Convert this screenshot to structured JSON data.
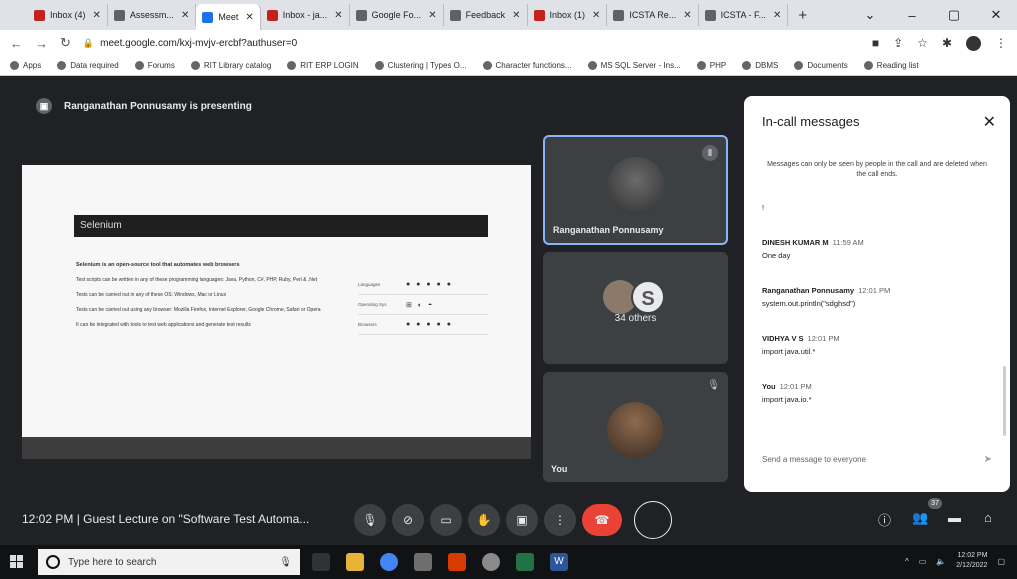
{
  "browser": {
    "tabs": [
      {
        "label": "Inbox (4)",
        "color": "#c5221f"
      },
      {
        "label": "Assessm...",
        "color": "#5f6368"
      },
      {
        "label": "Meet",
        "color": "#1a73e8"
      },
      {
        "label": "Inbox - ja...",
        "color": "#c5221f"
      },
      {
        "label": "Google Fo...",
        "color": "#5f6368"
      },
      {
        "label": "Feedback",
        "color": "#5f6368"
      },
      {
        "label": "Inbox (1)",
        "color": "#c5221f"
      },
      {
        "label": "ICSTA Re...",
        "color": "#5f6368"
      },
      {
        "label": "ICSTA - F...",
        "color": "#5f6368"
      }
    ],
    "url": "meet.google.com/kxj-mvjv-ercbf?authuser=0",
    "bookmarks": [
      "Apps",
      "Data required",
      "Forums",
      "RIT Library catalog",
      "RIT ERP LOGIN",
      "Clustering | Types O...",
      "Character functions...",
      "MS SQL Server - Ins...",
      "PHP",
      "DBMS",
      "Documents",
      "Reading list"
    ]
  },
  "meet": {
    "presenting_text": "Ranganathan Ponnusamy is presenting",
    "slide": {
      "title": "Selenium",
      "lines": [
        "Selenium is an open-source tool that automates web browsers",
        "Test scripts can be written in any of these programming languages: Java, Python, C#, PHP, Ruby, Perl & .Net",
        "Tests can be carried out in any of these OS: Windows, Mac or Linux",
        "Tests can be carried out using any browser: Mozilla Firefox, Internet Explorer, Google Chrome, Safari or Opera",
        "It can be integrated with tools to test web applications and generate test results"
      ],
      "table_rows": [
        {
          "label": "Languages",
          "icons": "● ● ● ● ●"
        },
        {
          "label": "Operating Sys",
          "icons": "⊞ ◐ ◓"
        },
        {
          "label": "Browsers",
          "icons": "● ● ● ● ●"
        }
      ]
    },
    "participants": [
      {
        "name": "Ranganathan Ponnusamy"
      },
      {
        "name": "34 others"
      },
      {
        "name": "You"
      }
    ],
    "meeting_info": "12:02 PM  |  Guest Lecture on \"Software Test Automa...",
    "people_count": "37"
  },
  "chat": {
    "title": "In-call messages",
    "info": "Messages can only be seen by people in the call and are deleted when the call ends.",
    "stray": "!",
    "messages": [
      {
        "sender": "DINESH KUMAR M",
        "time": "11:59 AM",
        "text": "One day"
      },
      {
        "sender": "Ranganathan Ponnusamy",
        "time": "12:01 PM",
        "text": "system.out.println(\"sdghsd\")"
      },
      {
        "sender": "VIDHYA V S",
        "time": "12:01 PM",
        "text": "import java.util.*"
      },
      {
        "sender": "You",
        "time": "12:01 PM",
        "text": "import java.io.*"
      }
    ],
    "input_placeholder": "Send a message to everyone"
  },
  "taskbar": {
    "search_placeholder": "Type here to search",
    "time": "12:02 PM",
    "date": "2/12/2022"
  }
}
